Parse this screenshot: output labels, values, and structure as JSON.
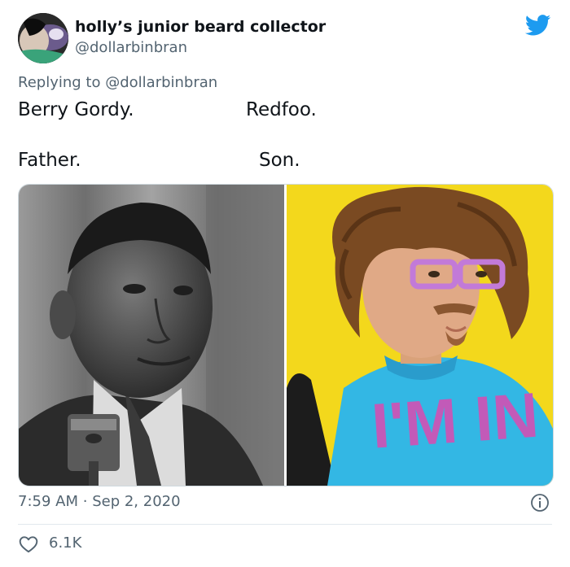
{
  "author": {
    "display_name": "holly’s junior beard collector",
    "handle": "@dollarbinbran"
  },
  "reply": {
    "prefix": "Replying to",
    "mention": "@dollarbinbran"
  },
  "tweet": {
    "left_top": "Berry Gordy.",
    "right_top": "Redfoo.",
    "left_bottom": "Father.",
    "right_bottom": "Son."
  },
  "meta": {
    "time": "7:59 AM",
    "separator": "·",
    "date": "Sep 2, 2020"
  },
  "shirt_text": "I'M IN",
  "stats": {
    "likes": "6.1K"
  },
  "icons": {
    "brand": "twitter-bird-icon",
    "info": "info-icon",
    "like": "heart-icon"
  },
  "colors": {
    "twitter_blue": "#1d9bf0",
    "secondary_text": "#536471",
    "yellow_backdrop": "#f3d81c",
    "shirt_blue": "#33b7e4",
    "glasses_purple": "#c27ad8"
  }
}
